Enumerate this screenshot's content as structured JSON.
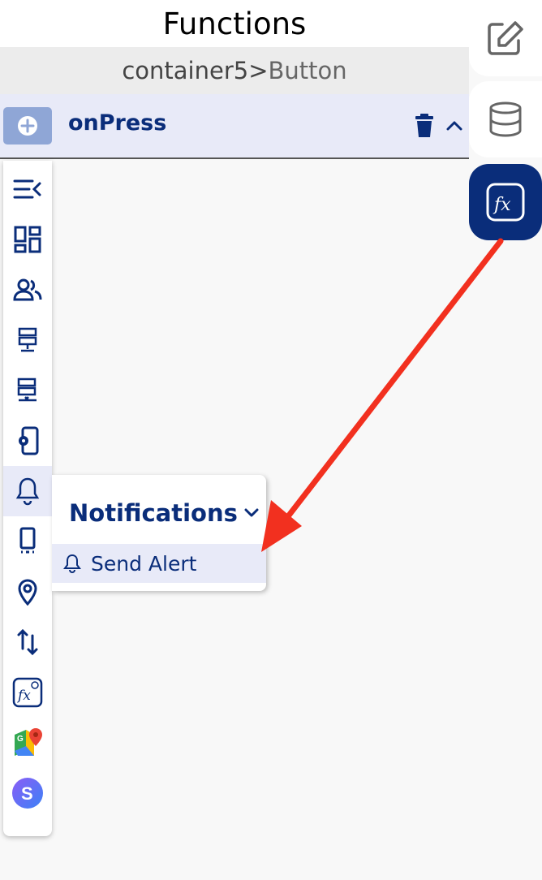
{
  "header": {
    "title": "Functions"
  },
  "breadcrumb": {
    "parent": "container5",
    "separator": ">",
    "leaf": "Button"
  },
  "event": {
    "name": "onPress"
  },
  "rail": {
    "items": [
      {
        "icon": "collapse-menu-icon"
      },
      {
        "icon": "dashboard-icon"
      },
      {
        "icon": "users-icon"
      },
      {
        "icon": "server-icon"
      },
      {
        "icon": "server-remove-icon"
      },
      {
        "icon": "device-settings-icon"
      },
      {
        "icon": "bell-icon",
        "active": true
      },
      {
        "icon": "mobile-device-icon"
      },
      {
        "icon": "location-pin-icon"
      },
      {
        "icon": "sort-arrows-icon"
      },
      {
        "icon": "add-function-icon"
      },
      {
        "icon": "google-maps-icon"
      },
      {
        "icon": "s-logo-icon"
      }
    ]
  },
  "flyout": {
    "title": "Notifications",
    "items": [
      {
        "label": "Send Alert",
        "icon": "bell-icon"
      }
    ]
  },
  "side_tabs": [
    {
      "icon": "edit-icon"
    },
    {
      "icon": "database-icon"
    },
    {
      "icon": "function-icon",
      "active": true
    }
  ],
  "colors": {
    "primary": "#0a2d7a",
    "highlight": "#e8eaf8",
    "annotation": "#f2301f"
  }
}
